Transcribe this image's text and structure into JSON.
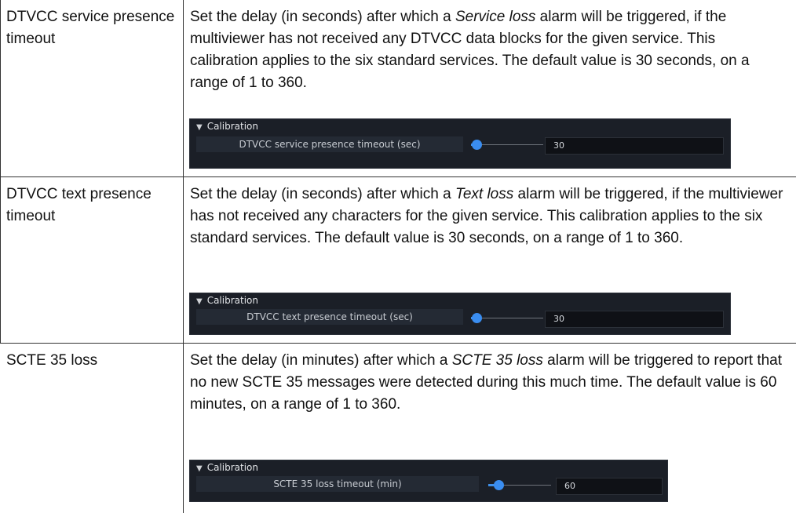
{
  "rows": [
    {
      "parameter": "DTVCC service presence timeout",
      "desc_before": "Set the delay (in seconds) after which a ",
      "desc_em": "Service loss",
      "desc_after": " alarm will be triggered, if the multiviewer has not received any DTVCC data blocks for the given service. This calibration applies to the six standard services. The default value is 30 seconds, on a range of 1 to 360.",
      "panel": {
        "header": "Calibration",
        "label": "DTVCC service presence timeout (sec)",
        "value": "30",
        "slider_fraction": 0.08
      }
    },
    {
      "parameter": "DTVCC text presence timeout",
      "desc_before": "Set the delay (in seconds) after which a ",
      "desc_em": "Text loss",
      "desc_after": " alarm will be triggered, if the multiviewer has not received any characters for the given service. This calibration applies to the six standard services. The default value is 30 seconds, on a range of 1 to 360.",
      "panel": {
        "header": "Calibration",
        "label": "DTVCC text presence timeout (sec)",
        "value": "30",
        "slider_fraction": 0.08
      }
    },
    {
      "parameter": "SCTE 35 loss",
      "desc_before": "Set the delay (in minutes) after which a ",
      "desc_em": "SCTE 35 loss",
      "desc_after": " alarm will be triggered to report that no new SCTE 35 messages were detected during this much time. The default value is 60 minutes, on a range of 1 to 360.",
      "panel": {
        "header": "Calibration",
        "label": "SCTE 35 loss timeout (min)",
        "value": "60",
        "slider_fraction": 0.16
      }
    }
  ]
}
